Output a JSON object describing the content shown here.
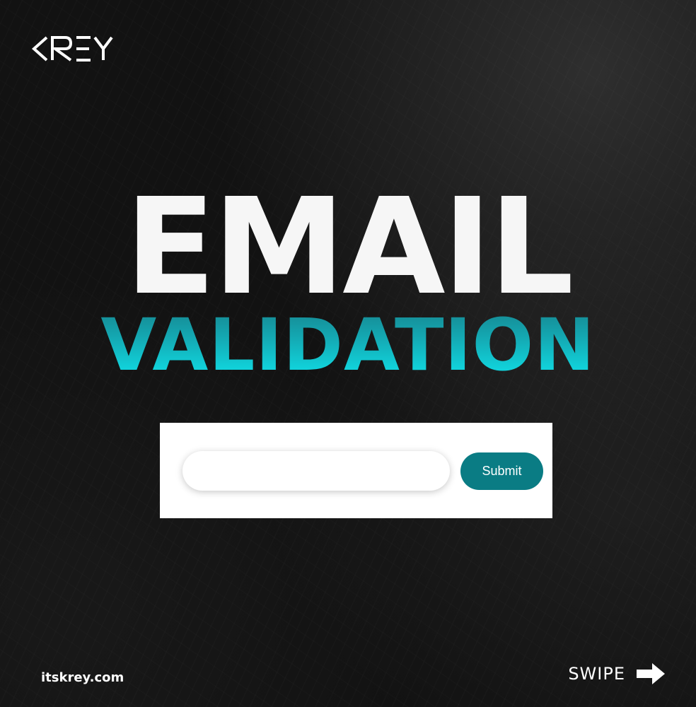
{
  "brand": {
    "logo_text": "KREY",
    "website": "itskrey.com"
  },
  "hero": {
    "title_line1": "EMAIL",
    "title_line2": "VALIDATION"
  },
  "form": {
    "email_value": "",
    "email_placeholder": "",
    "submit_label": "Submit"
  },
  "footer": {
    "swipe_label": "SWIPE",
    "swipe_icon": "arrow-right-icon"
  },
  "colors": {
    "background": "#121212",
    "accent_teal": "#0a7c84",
    "gradient_top": "#16858f",
    "gradient_bottom": "#0fe6ee",
    "title_white": "#f6f6f6"
  }
}
